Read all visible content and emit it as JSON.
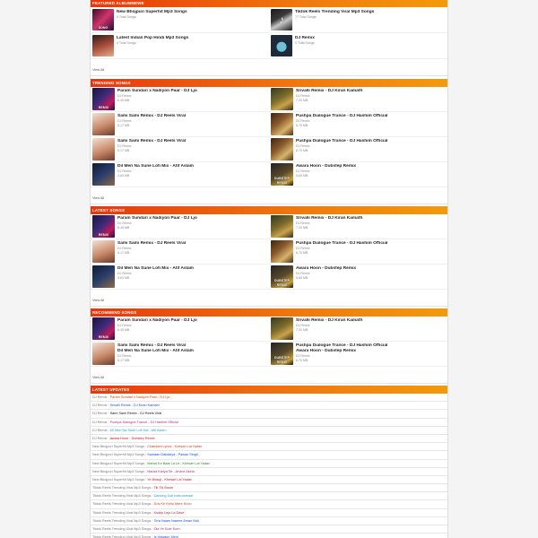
{
  "featured": {
    "heading": "FEATURED ALBUMMEWE",
    "items": [
      {
        "title": "New Bhojpuri Superhit Mp3 Songs",
        "count": "0 Total Songs",
        "thumb_text": "SONG"
      },
      {
        "title": "Tiktok Reels Trending Viral Mp3 Songs",
        "count": "77 Total Songs",
        "thumb_text": ""
      },
      {
        "title": "Latest Indian Pop Hindi Mp3 Songs",
        "count": "4 Total Songs",
        "thumb_text": ""
      },
      {
        "title": "DJ Remix",
        "count": "0 Total Songs",
        "thumb_text": ""
      }
    ],
    "view_all": "View All"
  },
  "trending": {
    "heading": "TRENDING SONGS",
    "items": [
      {
        "title": "Param Sundari x Nadiyon Paar - DJ Ljo",
        "artist": "DJ Remix",
        "size": "6.40 MB",
        "thumb_text": "REMIX"
      },
      {
        "title": "Srivalli Remix - DJ Kiran Kamath",
        "artist": "DJ Remix",
        "size": "7.20 MB",
        "thumb_text": ""
      },
      {
        "title": "Sami Sami Remix - DJ Reels Viral",
        "artist": "DJ Remix",
        "size": "5.17 MB",
        "thumb_text": ""
      },
      {
        "title": "Pushpa Dialogue Trance - DJ Hashim Official",
        "artist": "DJ Remix",
        "size": "6.70 MB",
        "thumb_text": ""
      },
      {
        "title": "Sami Sami Remix - DJ Reels Viral",
        "artist": "DJ Remix",
        "size": "5.17 MB",
        "thumb_text": ""
      },
      {
        "title": "Pushpa Dialogue Trance - DJ Hashim Official",
        "artist": "DJ Remix",
        "size": "6.70 MB",
        "thumb_text": ""
      },
      {
        "title": "Dil Meri Na Sune Lofi Mix - Atif Aslam",
        "artist": "DJ Remix",
        "size": "3.63 MB",
        "thumb_text": ""
      },
      {
        "title": "Awara Hoon - Dubstep Remix",
        "artist": "DJ Remix",
        "size": "5.65 MB",
        "thumb_text": "DUBSTEP REMIX"
      }
    ],
    "view_all": "View All"
  },
  "latest": {
    "heading": "LATEST SONGS",
    "items": [
      {
        "title": "Param Sundari x Nadiyon Paar - DJ Ljo",
        "artist": "DJ Remix",
        "size": "6.40 MB",
        "thumb_text": "REMIX"
      },
      {
        "title": "Srivalli Remix - DJ Kiran Kamath",
        "artist": "DJ Remix",
        "size": "7.20 MB",
        "thumb_text": ""
      },
      {
        "title": "Sami Sami Remix - DJ Reels Viral",
        "artist": "DJ Remix",
        "size": "5.17 MB",
        "thumb_text": ""
      },
      {
        "title": "Pushpa Dialogue Trance - DJ Hashim Official",
        "artist": "DJ Remix",
        "size": "6.70 MB",
        "thumb_text": ""
      },
      {
        "title": "Dil Meri Na Sune Lofi Mix - Atif Aslam",
        "artist": "DJ Remix",
        "size": "3.63 MB",
        "thumb_text": ""
      },
      {
        "title": "Awara Hoon - Dubstep Remix",
        "artist": "DJ Remix",
        "size": "5.65 MB",
        "thumb_text": "DUBSTEP REMIX"
      }
    ],
    "view_all": "View All"
  },
  "recommend": {
    "heading": "RECOMMEND SONGS",
    "items": [
      {
        "title": "Param Sundari x Nadiyon Paar - DJ Ljo",
        "artist": "DJ Remix",
        "size": "6.40 MB",
        "thumb_text": "REMIX"
      },
      {
        "title": "Srivalli Remix - DJ Kiran Kamath",
        "artist": "DJ Remix",
        "size": "7.20 MB",
        "thumb_text": ""
      },
      {
        "title": "Sami Sami Remix - DJ Reels Viral",
        "title2": "Dil Meri Na Sune Lofi Mix - Atif Aslam",
        "artist": "DJ Remix",
        "size": "5.17 MB",
        "thumb_text": ""
      },
      {
        "title": "Pushpa Dialogue Trance - DJ Hashim Official",
        "title2": "Awara Hoon - Dubstep Remix",
        "artist": "DJ Remix",
        "size": "6.70 MB",
        "thumb_text": "DUBSTEP REMIX"
      }
    ],
    "view_all": "View All"
  },
  "updates": {
    "heading": "LATEST UPDATES",
    "rows": [
      {
        "cat": "DJ Remix",
        "song": "Param Sundari x Nadiyon Paar - DJ Ljo",
        "color": "#e8370d"
      },
      {
        "cat": "DJ Remix",
        "song": "Srivalli Remix - DJ Kiran Kamath",
        "color": "#1a4fd8"
      },
      {
        "cat": "DJ Remix",
        "song": "Sami Sami Remix - DJ Reels Viral",
        "color": "#111111"
      },
      {
        "cat": "DJ Remix",
        "song": "Pushpa Dialogue Trance - DJ Hashim Official",
        "color": "#b0307a"
      },
      {
        "cat": "DJ Remix",
        "song": "Dil Meri Na Sune Lofi Mix - Atif Aslam",
        "color": "#1aa5d8"
      },
      {
        "cat": "DJ Remix",
        "song": "Awara Hoon - Dubstep Remix",
        "color": "#c0162a"
      },
      {
        "cat": "New Bhojpuri Superhit Mp3 Songs",
        "song": "Chandani Lyrics - Khesari Lal Yadav",
        "color": "#e8370d"
      },
      {
        "cat": "New Bhojpuri Superhit Mp3 Songs",
        "song": "Samaan Dabakiya - Pawan Singh",
        "color": "#1a4fd8"
      },
      {
        "cat": "New Bhojpuri Superhit Mp3 Songs",
        "song": "Marad Ke Baat La Le - Khesari Lal Yadav",
        "color": "#2a8a2a"
      },
      {
        "cat": "New Bhojpuri Superhit Mp3 Songs",
        "song": "Marad Kariya Se - Arvind Akela",
        "color": "#b0307a"
      },
      {
        "cat": "New Bhojpuri Superhit Mp3 Songs",
        "song": "Ye Bhauji - Khesari Lal Yadav",
        "color": "#c0162a"
      },
      {
        "cat": "Tiktok Reels Trending Viral Mp3 Songs",
        "song": "Tik Tik Boom",
        "color": "#c0162a"
      },
      {
        "cat": "Tiktok Reels Trending Viral Mp3 Songs",
        "song": "Dancing Doll Instrumental",
        "color": "#1aa5d8"
      },
      {
        "cat": "Tiktok Reels Trending Viral Mp3 Songs",
        "song": "Dus Ke Kehu Mere Khon",
        "color": "#e8370d"
      },
      {
        "cat": "Tiktok Reels Trending Viral Mp3 Songs",
        "song": "Kudiyi Lejo La Dave",
        "color": "#c0162a"
      },
      {
        "cat": "Tiktok Reels Trending Viral Mp3 Songs",
        "song": "Tera Naam Naame Aman Noh",
        "color": "#1a4fd8"
      },
      {
        "cat": "Tiktok Reels Trending Viral Mp3 Songs",
        "song": "Ola Ye Kute Kum",
        "color": "#b0307a"
      },
      {
        "cat": "Tiktok Reels Trending Viral Mp3 Songs",
        "song": "Is Hawaon Mein",
        "color": "#1a4fd8"
      }
    ]
  }
}
